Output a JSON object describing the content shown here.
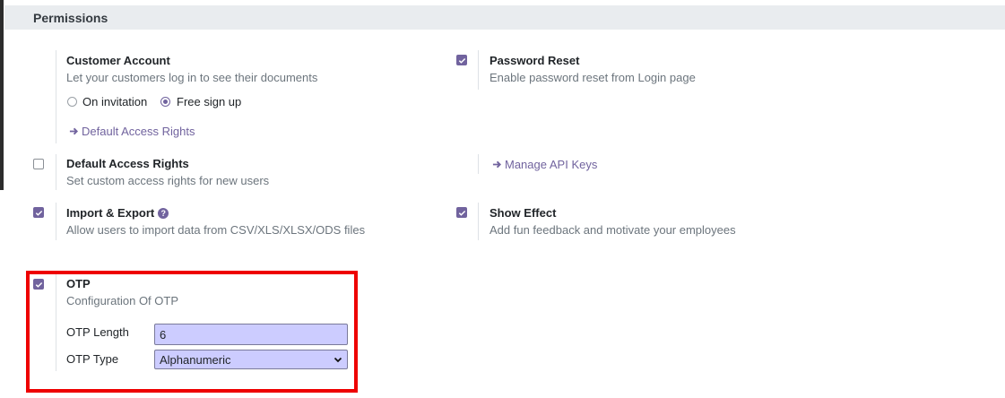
{
  "section": {
    "title": "Permissions"
  },
  "customer_account": {
    "title": "Customer Account",
    "description": "Let your customers log in to see their documents",
    "options": [
      "On invitation",
      "Free sign up"
    ],
    "selected": "Free sign up",
    "link": "Default Access Rights"
  },
  "password_reset": {
    "title": "Password Reset",
    "description": "Enable password reset from Login page",
    "checked": true
  },
  "default_access_rights": {
    "title": "Default Access Rights",
    "description": "Set custom access rights for new users",
    "checked": false
  },
  "api_keys": {
    "link": "Manage API Keys"
  },
  "import_export": {
    "title": "Import & Export",
    "description": "Allow users to import data from CSV/XLS/XLSX/ODS files",
    "checked": true
  },
  "show_effect": {
    "title": "Show Effect",
    "description": "Add fun feedback and motivate your employees",
    "checked": true
  },
  "otp": {
    "title": "OTP",
    "description": "Configuration Of OTP",
    "checked": true,
    "length_label": "OTP Length",
    "length_value": "6",
    "type_label": "OTP Type",
    "type_value": "Alphanumeric"
  },
  "colors": {
    "accent": "#71639e",
    "highlight": "#ee0000",
    "field_bg": "#ccccff"
  }
}
